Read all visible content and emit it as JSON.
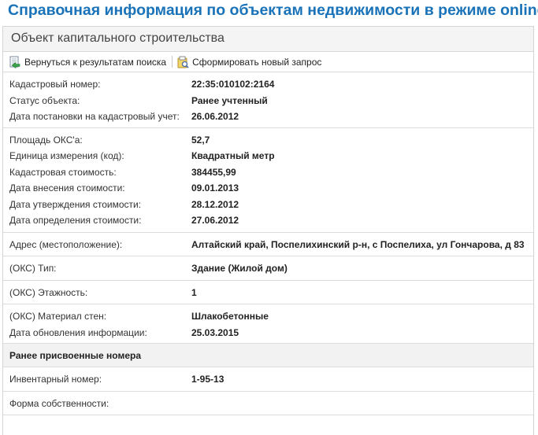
{
  "page": {
    "title": "Справочная информация по объектам недвижимости в режиме online"
  },
  "panel": {
    "title": "Объект капитального строительства",
    "toolbar": {
      "back_label": "Вернуться к результатам поиска",
      "new_request_label": "Сформировать новый запрос"
    }
  },
  "details": {
    "cadastral_number": {
      "label": "Кадастровый номер:",
      "value": "22:35:010102:2164"
    },
    "object_status": {
      "label": "Статус объекта:",
      "value": "Ранее учтенный"
    },
    "registration_date": {
      "label": "Дата постановки на кадастровый учет:",
      "value": "26.06.2012"
    },
    "area": {
      "label": "Площадь ОКС'а:",
      "value": "52,7"
    },
    "unit": {
      "label": "Единица измерения (код):",
      "value": "Квадратный метр"
    },
    "cadastral_value": {
      "label": "Кадастровая стоимость:",
      "value": "384455,99"
    },
    "value_entry_date": {
      "label": "Дата внесения стоимости:",
      "value": "09.01.2013"
    },
    "value_approval_date": {
      "label": "Дата утверждения стоимости:",
      "value": "28.12.2012"
    },
    "value_determination_date": {
      "label": "Дата определения стоимости:",
      "value": "27.06.2012"
    },
    "address": {
      "label": "Адрес (местоположение):",
      "value": "Алтайский край, Поспелихинский р-н, с Поспелиха, ул Гончарова, д 83"
    },
    "oks_type": {
      "label": "(ОКС) Тип:",
      "value": "Здание (Жилой дом)"
    },
    "oks_floors": {
      "label": "(ОКС) Этажность:",
      "value": "1"
    },
    "oks_wall_material": {
      "label": "(ОКС) Материал стен:",
      "value": "Шлакобетонные"
    },
    "info_update_date": {
      "label": "Дата обновления информации:",
      "value": "25.03.2015"
    }
  },
  "previous_numbers": {
    "heading": "Ранее присвоенные номера",
    "inventory_number": {
      "label": "Инвентарный номер:",
      "value": "1-95-13"
    }
  },
  "ownership_form": {
    "label": "Форма собственности:",
    "value": ""
  }
}
